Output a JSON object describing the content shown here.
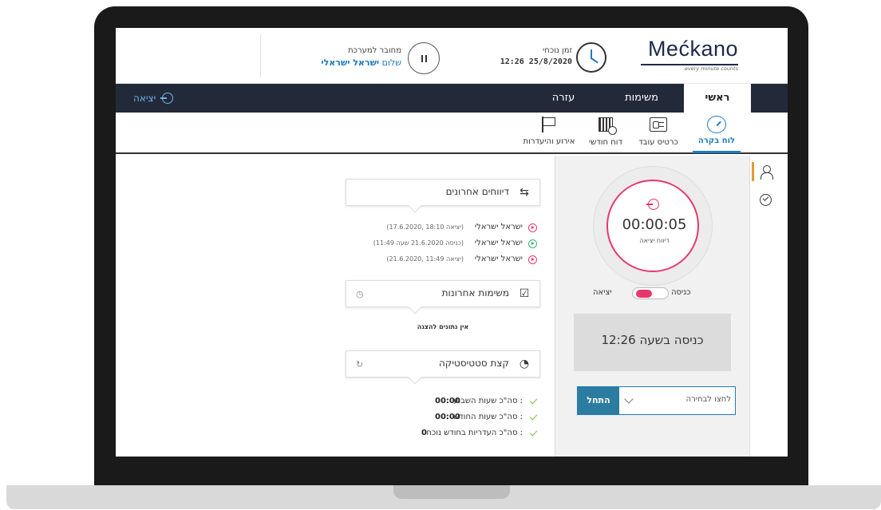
{
  "header": {
    "connected_label": "מחובר למערכת",
    "greeting_prefix": "שלום",
    "user_name": "ישראל ישראלי",
    "current_time_label": "זמן נוכחי",
    "current_time_value": "12:26 25/8/2020",
    "logo_text": "Mećkano",
    "logo_tagline": "every minute counts"
  },
  "nav": {
    "home": "ראשי",
    "tasks": "משימות",
    "help": "עזרה",
    "exit": "יציאה"
  },
  "subnav": {
    "items": [
      {
        "label": "לוח בקרה",
        "icon": "gauge-icon",
        "active": true
      },
      {
        "label": "כרטיס עובד",
        "icon": "employee-card-icon",
        "active": false
      },
      {
        "label": "דוח חודשי",
        "icon": "calendar-report-icon",
        "active": false
      },
      {
        "label": "אירוע והיעדרות",
        "icon": "flag-icon",
        "active": false
      }
    ]
  },
  "clock_panel": {
    "timer": "00:00:05",
    "timer_sub": "דיווח יציאה",
    "toggle_in": "כניסה",
    "toggle_out": "יציאה",
    "entry_text": "כניסה בשעה 12:26",
    "select_placeholder": "לחצו לבחירה",
    "start_button": "התחל"
  },
  "widgets": {
    "recent_reports": {
      "title": "דיווחים אחרונים",
      "items": [
        {
          "name": "ישראל ישראלי",
          "detail": "(יציאה 18:10 ,17.6.2020)",
          "type": "exit"
        },
        {
          "name": "ישראל ישראלי",
          "detail": "(כניסה 21.6.2020 שעה 11:49)",
          "type": "entry"
        },
        {
          "name": "ישראל ישראלי",
          "detail": "(יציאה 11:49 ,21.6.2020)",
          "type": "exit"
        }
      ]
    },
    "recent_tasks": {
      "title": "משימות אחרונות",
      "empty_text": "אין נתונים להצגה"
    },
    "stats": {
      "title": "קצת סטטיסטיקה",
      "items": [
        {
          "label": "סה\"כ שעות השבוע :",
          "value": "00:00"
        },
        {
          "label": "סה\"כ שעות החודש :",
          "value": "00:00"
        },
        {
          "label": "סה\"כ העדריות בחודש נוכחי :",
          "value": "0"
        }
      ]
    }
  },
  "colors": {
    "accent_blue": "#1f7bbf",
    "nav_dark": "#222a3a",
    "pink": "#e8386b",
    "start_teal": "#2b7ca0"
  }
}
